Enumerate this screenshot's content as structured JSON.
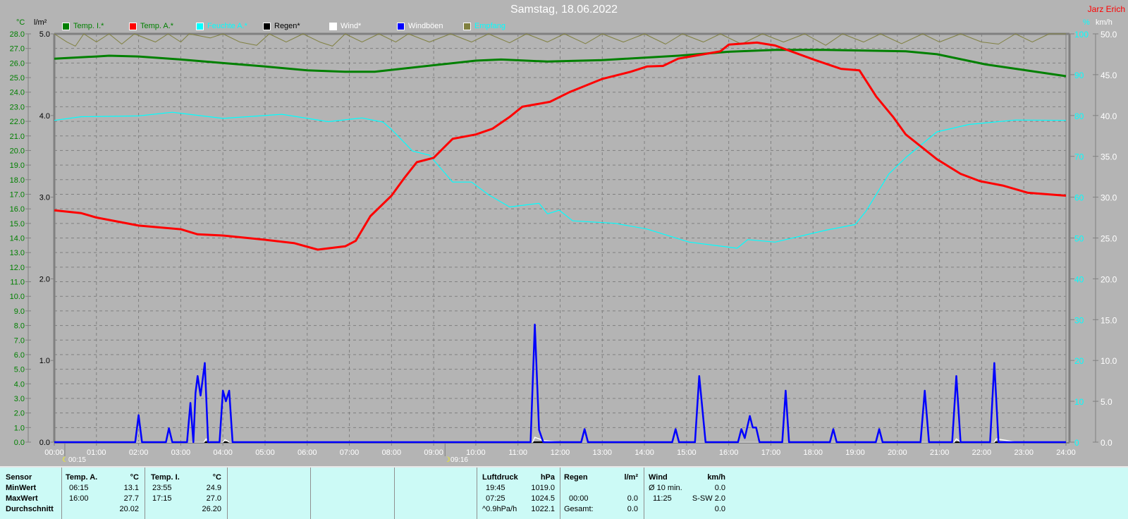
{
  "header": {
    "title": "Samstag, 18.06.2022",
    "author": "Jarz Erich"
  },
  "units": {
    "temp": "°C",
    "rain": "l/m²",
    "humidity": "%",
    "wind": "km/h"
  },
  "legend": [
    {
      "label": "Temp. I.*",
      "color": "#008000",
      "text_color": "#008000"
    },
    {
      "label": "Temp. A.*",
      "color": "#ff0000",
      "text_color": "#008000"
    },
    {
      "label": "Feuchte A.*",
      "color": "#00ffff",
      "text_color": "#00ffff"
    },
    {
      "label": "Regen*",
      "color": "#000000",
      "text_color": "#000000"
    },
    {
      "label": "Wind*",
      "color": "#ffffff",
      "text_color": "#ffffff"
    },
    {
      "label": "Windböen",
      "color": "#0000ff",
      "text_color": "#ffffff"
    },
    {
      "label": "Empfang",
      "color": "#808040",
      "text_color": "#00ffff"
    }
  ],
  "markers": [
    {
      "time": "00:15",
      "hour": 0.25
    },
    {
      "time": "09:16",
      "hour": 9.27
    }
  ],
  "chart_data": {
    "type": "line",
    "x_unit": "hour",
    "xlim": [
      0,
      24
    ],
    "x_ticks": [
      "00:00",
      "01:00",
      "02:00",
      "03:00",
      "04:00",
      "05:00",
      "06:00",
      "07:00",
      "08:00",
      "09:00",
      "10:00",
      "11:00",
      "12:00",
      "13:00",
      "14:00",
      "15:00",
      "16:00",
      "17:00",
      "18:00",
      "19:00",
      "20:00",
      "21:00",
      "22:00",
      "23:00",
      "24:00"
    ],
    "axes": {
      "temp": {
        "range": [
          0,
          28
        ],
        "step": 1,
        "color": "#008000"
      },
      "rain": {
        "range": [
          0,
          5
        ],
        "step": 1,
        "color": "#000000"
      },
      "humidity": {
        "range": [
          0,
          100
        ],
        "step": 10,
        "color": "#00ffff"
      },
      "wind": {
        "range": [
          0,
          50
        ],
        "step": 5,
        "color": "#ffffff"
      }
    },
    "grid": true,
    "series": [
      {
        "name": "Temp. I.*",
        "axis": "temp",
        "color": "#008000",
        "points": [
          [
            0,
            26.3
          ],
          [
            1,
            26.45
          ],
          [
            1.3,
            26.5
          ],
          [
            2,
            26.45
          ],
          [
            3,
            26.24
          ],
          [
            4,
            26.0
          ],
          [
            5,
            25.76
          ],
          [
            6,
            25.5
          ],
          [
            6.9,
            25.4
          ],
          [
            7.6,
            25.4
          ],
          [
            9,
            25.85
          ],
          [
            10,
            26.16
          ],
          [
            10.6,
            26.24
          ],
          [
            11.7,
            26.1
          ],
          [
            13,
            26.2
          ],
          [
            14.8,
            26.5
          ],
          [
            16,
            26.77
          ],
          [
            17.1,
            26.9
          ],
          [
            18.3,
            26.9
          ],
          [
            20.2,
            26.8
          ],
          [
            20.94,
            26.6
          ],
          [
            22.1,
            25.9
          ],
          [
            24,
            25.1
          ]
        ]
      },
      {
        "name": "Temp. A.*",
        "axis": "temp",
        "color": "#ff0000",
        "points": [
          [
            0,
            15.9
          ],
          [
            0.64,
            15.7
          ],
          [
            1,
            15.4
          ],
          [
            2,
            14.85
          ],
          [
            3,
            14.6
          ],
          [
            3.4,
            14.25
          ],
          [
            4,
            14.17
          ],
          [
            5,
            13.88
          ],
          [
            5.7,
            13.64
          ],
          [
            6.25,
            13.2
          ],
          [
            6.9,
            13.43
          ],
          [
            7.15,
            13.8
          ],
          [
            7.5,
            15.5
          ],
          [
            8,
            16.9
          ],
          [
            8.3,
            18.1
          ],
          [
            8.6,
            19.2
          ],
          [
            9,
            19.5
          ],
          [
            9.45,
            20.8
          ],
          [
            10,
            21.1
          ],
          [
            10.4,
            21.5
          ],
          [
            10.8,
            22.3
          ],
          [
            11.1,
            23.0
          ],
          [
            11.76,
            23.34
          ],
          [
            12.22,
            24.0
          ],
          [
            12.99,
            24.9
          ],
          [
            13.67,
            25.4
          ],
          [
            14.06,
            25.76
          ],
          [
            14.44,
            25.8
          ],
          [
            14.8,
            26.3
          ],
          [
            15.6,
            26.7
          ],
          [
            15.8,
            26.8
          ],
          [
            16.0,
            27.26
          ],
          [
            16.67,
            27.4
          ],
          [
            17.1,
            27.2
          ],
          [
            18.05,
            26.2
          ],
          [
            18.66,
            25.6
          ],
          [
            19.1,
            25.5
          ],
          [
            19.5,
            23.7
          ],
          [
            19.9,
            22.3
          ],
          [
            20.2,
            21.1
          ],
          [
            20.94,
            19.4
          ],
          [
            21.5,
            18.4
          ],
          [
            21.96,
            17.9
          ],
          [
            22.5,
            17.6
          ],
          [
            23.1,
            17.1
          ],
          [
            24,
            16.9
          ]
        ]
      },
      {
        "name": "Feuchte A.*",
        "axis": "humidity",
        "color": "#00ffff",
        "points": [
          [
            0,
            78.8
          ],
          [
            0.64,
            79.7
          ],
          [
            2,
            79.9
          ],
          [
            2.8,
            80.8
          ],
          [
            4,
            79.3
          ],
          [
            5.4,
            80.3
          ],
          [
            6.5,
            78.5
          ],
          [
            7.3,
            79.4
          ],
          [
            7.8,
            78.4
          ],
          [
            8,
            76.6
          ],
          [
            8.5,
            71.3
          ],
          [
            8.9,
            70.3
          ],
          [
            9.45,
            63.7
          ],
          [
            9.9,
            63.7
          ],
          [
            10.3,
            60.6
          ],
          [
            10.8,
            57.6
          ],
          [
            11.5,
            58.5
          ],
          [
            11.7,
            55.9
          ],
          [
            11.98,
            56.8
          ],
          [
            12.3,
            54.2
          ],
          [
            13.3,
            53.6
          ],
          [
            14.06,
            52.2
          ],
          [
            15.06,
            49.0
          ],
          [
            16.2,
            47.5
          ],
          [
            16.45,
            49.6
          ],
          [
            17.1,
            49.0
          ],
          [
            18.3,
            51.9
          ],
          [
            19.0,
            53.3
          ],
          [
            19.25,
            56.5
          ],
          [
            19.8,
            65.7
          ],
          [
            20.2,
            69.7
          ],
          [
            20.94,
            76.0
          ],
          [
            21.7,
            77.8
          ],
          [
            22.8,
            78.9
          ],
          [
            24,
            78.8
          ]
        ]
      },
      {
        "name": "Regen*",
        "axis": "rain",
        "color": "#000000",
        "points": [
          [
            0,
            0
          ],
          [
            24,
            0
          ]
        ]
      },
      {
        "name": "Wind*",
        "axis": "wind",
        "color": "#ffffff",
        "points": [
          [
            0,
            0
          ],
          [
            3.55,
            0
          ],
          [
            3.6,
            0.4
          ],
          [
            3.7,
            0
          ],
          [
            4.0,
            0
          ],
          [
            4.05,
            0.3
          ],
          [
            4.15,
            0
          ],
          [
            11.35,
            0
          ],
          [
            11.4,
            0.6
          ],
          [
            11.6,
            0.2
          ],
          [
            12.0,
            0
          ],
          [
            21.35,
            0
          ],
          [
            21.4,
            0.4
          ],
          [
            21.5,
            0
          ],
          [
            22.3,
            0
          ],
          [
            22.35,
            0.4
          ],
          [
            22.6,
            0.2
          ],
          [
            22.8,
            0
          ],
          [
            24,
            0
          ]
        ]
      },
      {
        "name": "Windböen",
        "axis": "wind",
        "color": "#0000ff",
        "points": [
          [
            0,
            0
          ],
          [
            1.92,
            0
          ],
          [
            2.0,
            3.3
          ],
          [
            2.08,
            0
          ],
          [
            2.65,
            0
          ],
          [
            2.72,
            1.7
          ],
          [
            2.8,
            0
          ],
          [
            3.15,
            0
          ],
          [
            3.23,
            4.8
          ],
          [
            3.3,
            0
          ],
          [
            3.35,
            6
          ],
          [
            3.4,
            8.1
          ],
          [
            3.47,
            5.7
          ],
          [
            3.57,
            9.7
          ],
          [
            3.65,
            0
          ],
          [
            3.92,
            0
          ],
          [
            4.0,
            6.3
          ],
          [
            4.07,
            5.0
          ],
          [
            4.15,
            6.3
          ],
          [
            4.23,
            0
          ],
          [
            11.3,
            0
          ],
          [
            11.4,
            14.4
          ],
          [
            11.5,
            1.5
          ],
          [
            11.6,
            0
          ],
          [
            12.5,
            0
          ],
          [
            12.58,
            1.6
          ],
          [
            12.66,
            0
          ],
          [
            14.66,
            0
          ],
          [
            14.74,
            1.6
          ],
          [
            14.82,
            0
          ],
          [
            15.2,
            0
          ],
          [
            15.3,
            8.1
          ],
          [
            15.45,
            0
          ],
          [
            16.22,
            0
          ],
          [
            16.3,
            1.6
          ],
          [
            16.38,
            0.5
          ],
          [
            16.5,
            3.2
          ],
          [
            16.57,
            1.8
          ],
          [
            16.65,
            1.8
          ],
          [
            16.73,
            0
          ],
          [
            17.27,
            0
          ],
          [
            17.35,
            6.3
          ],
          [
            17.43,
            0
          ],
          [
            18.4,
            0
          ],
          [
            18.48,
            1.6
          ],
          [
            18.56,
            0
          ],
          [
            19.49,
            0
          ],
          [
            19.57,
            1.6
          ],
          [
            19.65,
            0
          ],
          [
            20.55,
            0
          ],
          [
            20.65,
            6.3
          ],
          [
            20.75,
            0
          ],
          [
            21.3,
            0
          ],
          [
            21.4,
            8.1
          ],
          [
            21.5,
            0
          ],
          [
            22.2,
            0
          ],
          [
            22.3,
            9.7
          ],
          [
            22.4,
            0
          ],
          [
            24,
            0
          ]
        ]
      },
      {
        "name": "Empfang",
        "axis": "humidity",
        "color": "#808040",
        "points": [
          [
            0,
            100
          ],
          [
            0.3,
            98
          ],
          [
            0.5,
            97
          ],
          [
            0.7,
            100
          ],
          [
            1.0,
            98
          ],
          [
            1.3,
            100
          ],
          [
            1.6,
            97.5
          ],
          [
            1.9,
            100
          ],
          [
            2.4,
            98
          ],
          [
            2.7,
            100
          ],
          [
            3.0,
            98
          ],
          [
            3.2,
            100
          ],
          [
            3.7,
            99
          ],
          [
            4.0,
            100
          ],
          [
            4.4,
            98
          ],
          [
            4.8,
            97.2
          ],
          [
            5.1,
            100
          ],
          [
            5.5,
            98
          ],
          [
            5.9,
            100
          ],
          [
            6.3,
            98
          ],
          [
            6.6,
            97
          ],
          [
            6.9,
            100
          ],
          [
            7.3,
            98
          ],
          [
            7.7,
            100
          ],
          [
            8.1,
            98
          ],
          [
            8.4,
            100
          ],
          [
            8.9,
            98
          ],
          [
            9.4,
            100
          ],
          [
            9.9,
            98
          ],
          [
            10.3,
            100
          ],
          [
            10.8,
            97.8
          ],
          [
            11.2,
            100
          ],
          [
            11.7,
            98
          ],
          [
            12.1,
            100
          ],
          [
            12.6,
            97.6
          ],
          [
            13.0,
            100
          ],
          [
            13.5,
            98
          ],
          [
            14.0,
            100
          ],
          [
            14.5,
            97.5
          ],
          [
            14.9,
            100
          ],
          [
            15.4,
            98
          ],
          [
            15.8,
            100
          ],
          [
            16.3,
            97.5
          ],
          [
            16.8,
            100
          ],
          [
            17.3,
            98
          ],
          [
            17.8,
            100
          ],
          [
            18.3,
            97.2
          ],
          [
            18.7,
            100
          ],
          [
            19.2,
            98
          ],
          [
            19.6,
            100
          ],
          [
            20.1,
            97.6
          ],
          [
            20.6,
            100
          ],
          [
            21.0,
            98
          ],
          [
            21.5,
            100
          ],
          [
            22.0,
            98
          ],
          [
            22.4,
            97.5
          ],
          [
            22.8,
            100
          ],
          [
            23.2,
            98
          ],
          [
            23.6,
            100
          ],
          [
            24,
            100
          ]
        ]
      }
    ]
  },
  "table": {
    "row_labels": [
      "Sensor",
      "MinWert",
      "MaxWert",
      "Durchschnitt"
    ],
    "columns": [
      {
        "name": "Temp. A.",
        "unit": "°C",
        "rows": [
          [
            "06:15",
            "13.1"
          ],
          [
            "16:00",
            "27.7"
          ],
          [
            "",
            "20.02"
          ]
        ]
      },
      {
        "name": "Temp. I.",
        "unit": "°C",
        "rows": [
          [
            "23:55",
            "24.9"
          ],
          [
            "17:15",
            "27.0"
          ],
          [
            "",
            "26.20"
          ]
        ]
      },
      {
        "name": "Luftdruck",
        "unit": "hPa",
        "rows": [
          [
            "19:45",
            "1019.0"
          ],
          [
            "07:25",
            "1024.5"
          ],
          [
            "^0.9hPa/h",
            "1022.1"
          ]
        ]
      },
      {
        "name": "Regen",
        "unit": "l/m²",
        "rows": [
          [
            "",
            ""
          ],
          [
            "00:00",
            "0.0"
          ],
          [
            "Gesamt:",
            "0.0"
          ]
        ]
      },
      {
        "name": "Wind",
        "unit": "km/h",
        "rows": [
          [
            "Ø 10 min.",
            "0.0"
          ],
          [
            "11:25",
            "S-SW 2.0"
          ],
          [
            "",
            "0.0"
          ]
        ]
      }
    ]
  }
}
